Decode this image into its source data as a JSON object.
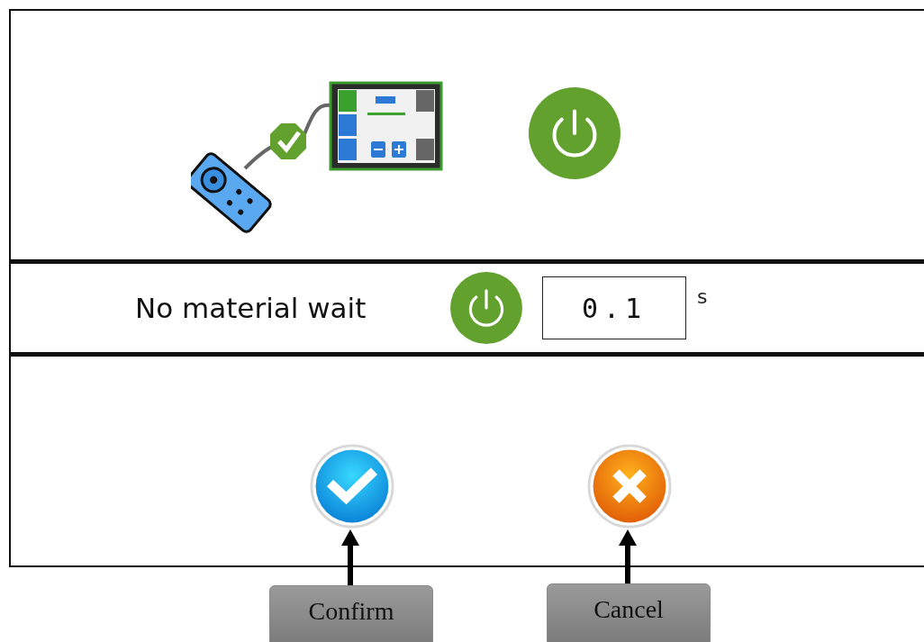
{
  "top_section": {
    "power_button": {
      "on": true
    }
  },
  "setting": {
    "label": "No material wait",
    "power": {
      "on": true
    },
    "value": "0.1",
    "unit": "s"
  },
  "buttons": [
    {
      "kind": "confirm",
      "callout": "Confirm"
    },
    {
      "kind": "cancel",
      "callout": "Cancel"
    }
  ]
}
